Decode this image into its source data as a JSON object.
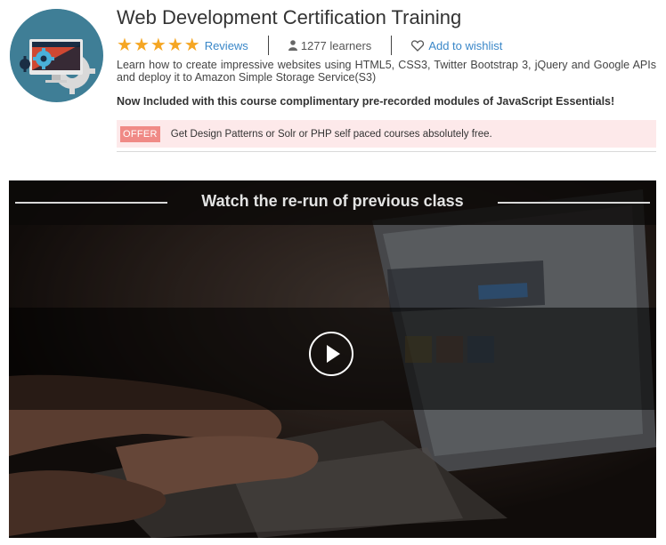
{
  "course": {
    "title": "Web Development Certification Training",
    "rating_stars": 5,
    "reviews_label": "Reviews",
    "learners": "1277 learners",
    "wishlist_label": "Add to wishlist",
    "description": "Learn how to create impressive websites using HTML5, CSS3, Twitter Bootstrap 3, jQuery and Google APIs and deploy it to Amazon Simple Storage Service(S3)",
    "included_note": "Now Included with this course complimentary pre-recorded modules of JavaScript Essentials!"
  },
  "offer": {
    "badge": "OFFER",
    "text": "Get Design Patterns or Solr or PHP self paced courses absolutely free."
  },
  "video": {
    "title": "Watch the re-run of previous class"
  },
  "icons": {
    "logo": "web-development-logo-icon",
    "star": "star-icon",
    "learners": "user-icon",
    "wishlist": "heart-icon",
    "play": "play-icon"
  },
  "colors": {
    "star": "#f5a623",
    "link": "#3a87c8",
    "offer_bg": "#fde9ea",
    "offer_badge": "#f08a86",
    "logo_bg": "#3f7e96"
  }
}
